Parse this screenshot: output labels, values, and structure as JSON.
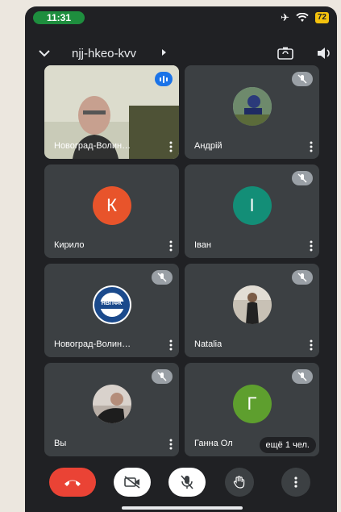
{
  "status_bar": {
    "time": "11:31",
    "battery": "72"
  },
  "header": {
    "meeting_code": "njj-hkeo-kvv"
  },
  "tiles": [
    {
      "name": "Новоград-Волин…",
      "state": "speaking",
      "content": "video"
    },
    {
      "name": "Андрій",
      "state": "muted",
      "content": "photo-avatar"
    },
    {
      "name": "Кирило",
      "state": "unmuted",
      "content": "letter-avatar",
      "letter": "К",
      "avatar_color": "#e8542b"
    },
    {
      "name": "Іван",
      "state": "muted",
      "content": "letter-avatar",
      "letter": "І",
      "avatar_color": "#138e77"
    },
    {
      "name": "Новоград-Волин…",
      "state": "muted",
      "content": "logo-avatar",
      "logo_text": "НВПФК"
    },
    {
      "name": "Natalia",
      "state": "muted",
      "content": "photo-avatar"
    },
    {
      "name": "Вы",
      "state": "muted",
      "content": "photo-avatar"
    },
    {
      "name": "Ганна Ол",
      "state": "muted",
      "content": "letter-avatar",
      "letter": "Г",
      "avatar_color": "#5e9f2e"
    }
  ],
  "overflow_pill": "ещё 1 чел.",
  "colors": {
    "background": "#202124",
    "tile": "#3c4043",
    "end_call": "#ea4335",
    "speaking": "#1a73e8"
  }
}
